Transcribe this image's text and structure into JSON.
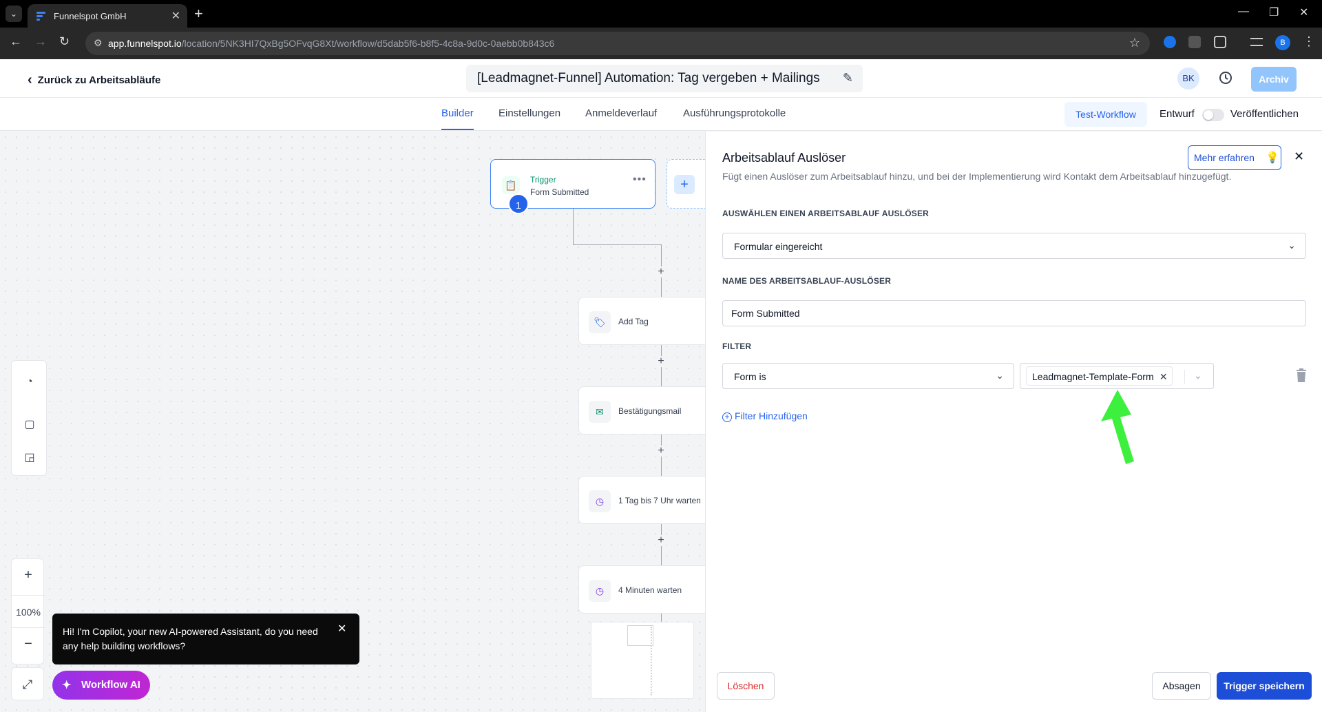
{
  "browser": {
    "tab_title": "Funnelspot GmbH",
    "url_host": "app.funnelspot.io",
    "url_path": "/location/5NK3HI7QxBg5OFvqG8Xt/workflow/d5dab5f6-b8f5-4c8a-9d0c-0aebb0b843c6",
    "profile_initial": "B"
  },
  "header": {
    "back_label": "Zurück zu Arbeitsabläufe",
    "workflow_title": "[Leadmagnet-Funnel] Automation: Tag vergeben + Mailings",
    "avatar_initials": "BK",
    "archive_label": "Archiv"
  },
  "subnav": {
    "tabs": [
      {
        "label": "Builder",
        "active": true
      },
      {
        "label": "Einstellungen",
        "active": false
      },
      {
        "label": "Anmeldeverlauf",
        "active": false
      },
      {
        "label": "Ausführungsprotokolle",
        "active": false
      }
    ],
    "test_workflow_label": "Test-Workflow",
    "draft_label": "Entwurf",
    "publish_label": "Veröffentlichen",
    "published": false
  },
  "canvas": {
    "trigger": {
      "label": "Trigger",
      "subtitle": "Form Submitted",
      "step_number": "1"
    },
    "actions": [
      {
        "label": "Add Tag",
        "icon": "tag-icon"
      },
      {
        "label": "Bestätigungsmail",
        "icon": "email-icon"
      },
      {
        "label": "1 Tag bis 7 Uhr warten",
        "icon": "clock-icon"
      },
      {
        "label": "4 Minuten warten",
        "icon": "clock-icon"
      }
    ],
    "zoom_level": "100%",
    "copilot_message": "Hi! I'm Copilot, your new AI-powered Assistant, do you need any help building workflows?",
    "workflow_ai_label": "Workflow AI"
  },
  "panel": {
    "title": "Arbeitsablauf Auslöser",
    "description": "Fügt einen Auslöser zum Arbeitsablauf hinzu, und bei der Implementierung wird Kontakt dem Arbeitsablauf hinzugefügt.",
    "learn_more_label": "Mehr erfahren",
    "select_trigger_label": "AUSWÄHLEN EINEN ARBEITSABLAUF AUSLÖSER",
    "selected_trigger": "Formular eingereicht",
    "trigger_name_label": "NAME DES ARBEITSABLAUF-AUSLÖSER",
    "trigger_name_value": "Form Submitted",
    "filter_label": "FILTER",
    "filter_condition": "Form is",
    "filter_value_chip": "Leadmagnet-Template-Form",
    "add_filter_label": "Filter Hinzufügen",
    "delete_label": "Löschen",
    "cancel_label": "Absagen",
    "save_label": "Trigger speichern"
  },
  "colors": {
    "primary": "#2563eb",
    "danger": "#dc2626",
    "annotation_arrow": "#3ef03e",
    "trigger_green": "#059669"
  }
}
